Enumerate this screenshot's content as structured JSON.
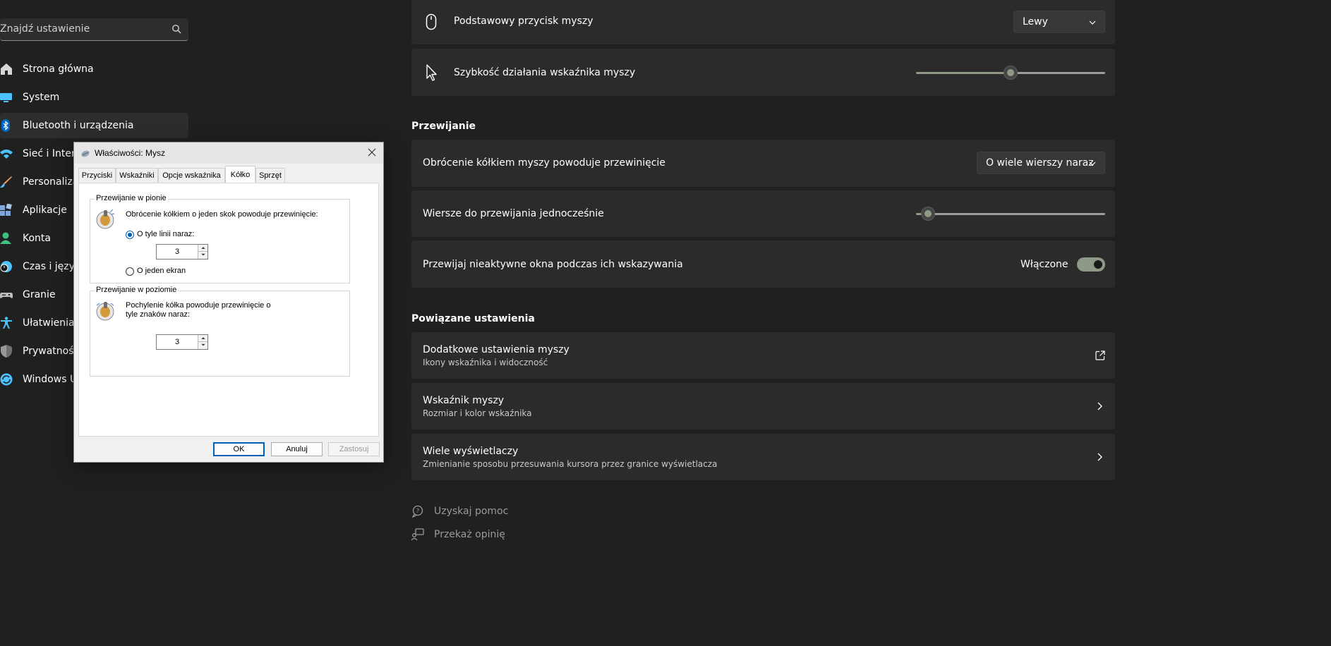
{
  "sidebar": {
    "search": {
      "placeholder": "Znajdź ustawienie"
    },
    "items": [
      {
        "label": "Strona główna",
        "icon": "home-icon",
        "color": "#d7d7d7"
      },
      {
        "label": "System",
        "icon": "monitor-icon",
        "color": "#4cc2ff"
      },
      {
        "label": "Bluetooth i urządzenia",
        "icon": "bluetooth-icon",
        "color": "#0067c0",
        "active": true
      },
      {
        "label": "Sieć i Intern",
        "icon": "wifi-icon",
        "color": "#4cc2ff"
      },
      {
        "label": "Personalizac",
        "icon": "brush-icon",
        "color": "#f7a35c"
      },
      {
        "label": "Aplikacje",
        "icon": "apps-icon",
        "color": "#7fa6d8"
      },
      {
        "label": "Konta",
        "icon": "person-icon",
        "color": "#3fbf7f"
      },
      {
        "label": "Czas i język",
        "icon": "clock-globe-icon",
        "color": "#4cc2ff"
      },
      {
        "label": "Granie",
        "icon": "gamepad-icon",
        "color": "#bdbdbd"
      },
      {
        "label": "Ułatwienia d",
        "icon": "accessibility-icon",
        "color": "#4cc2ff"
      },
      {
        "label": "Prywatność",
        "icon": "shield-icon",
        "color": "#9a9a9a"
      },
      {
        "label": "Windows U",
        "icon": "update-icon",
        "color": "#4cc2ff"
      }
    ]
  },
  "main": {
    "primary_button": {
      "label": "Podstawowy przycisk myszy",
      "value": "Lewy"
    },
    "pointer_speed": {
      "label": "Szybkość działania wskaźnika myszy",
      "level": 0.5
    },
    "scrolling_header": "Przewijanie",
    "wheel_scroll": {
      "label": "Obrócenie kółkiem myszy powoduje przewinięcie",
      "value": "O wiele wierszy naraz"
    },
    "lines_to_scroll": {
      "label": "Wiersze do przewijania jednocześnie",
      "level": 0.03
    },
    "inactive_scroll": {
      "label": "Przewijaj nieaktywne okna podczas ich wskazywania",
      "state": "Włączone"
    },
    "related_header": "Powiązane ustawienia",
    "related": [
      {
        "title": "Dodatkowe ustawienia myszy",
        "subtitle": "Ikony wskaźnika i widoczność",
        "icon": "external-link-icon"
      },
      {
        "title": "Wskaźnik myszy",
        "subtitle": "Rozmiar i kolor wskaźnika",
        "icon": "chevron-right-icon"
      },
      {
        "title": "Wiele wyświetlaczy",
        "subtitle": "Zmienianie sposobu przesuwania kursora przez granice wyświetlacza",
        "icon": "chevron-right-icon"
      }
    ],
    "help": "Uzyskaj pomoc",
    "feedback": "Przekaż opinię"
  },
  "dialog": {
    "title": "Właściwości: Mysz",
    "tabs": [
      "Przyciski",
      "Wskaźniki",
      "Opcje wskaźnika",
      "Kółko",
      "Sprzęt"
    ],
    "active_tab": "Kółko",
    "vertical": {
      "title": "Przewijanie w pionie",
      "description": "Obrócenie kółkiem o jeden skok powoduje przewinięcie:",
      "option_lines": "O tyle linii naraz:",
      "lines_value": "3",
      "option_screen": "O jeden ekran"
    },
    "horizontal": {
      "title": "Przewijanie w poziomie",
      "description_1": "Pochylenie kółka powoduje przewinięcie o",
      "description_2": "tyle znaków naraz:",
      "chars_value": "3"
    },
    "buttons": {
      "ok": "OK",
      "cancel": "Anuluj",
      "apply": "Zastosuj"
    }
  }
}
